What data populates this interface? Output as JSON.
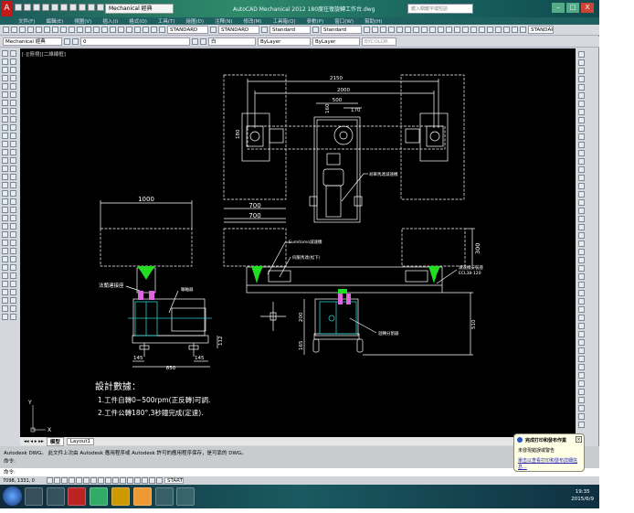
{
  "window": {
    "title": "AutoCAD Mechanical 2012   180度往復旋轉工作台.dwg",
    "workspace": "Mechanical 經典",
    "search_placeholder": "鍵入關鍵字或短語",
    "controls": [
      "–",
      "□",
      "X"
    ]
  },
  "menu": [
    "文件(F)",
    "編輯(E)",
    "視圖(V)",
    "插入(I)",
    "格式(O)",
    "工具(T)",
    "繪圖(D)",
    "注釋(N)",
    "修改(M)",
    "工具箱(Q)",
    "參數(P)",
    "窗口(W)",
    "幫助(H)"
  ],
  "toolbar1": {
    "text_style": "STANDARD",
    "dim_style": "STANDARD",
    "table_style": "Standard",
    "mleader_style": "Standard",
    "right_style": "STANDARD"
  },
  "toolbar2": {
    "workspace": "Mechanical 經典",
    "layer": "0",
    "color": "白",
    "linetype": "ByLayer",
    "lineweight": "ByLayer",
    "plotstyle": "BYCOLOR"
  },
  "viewport_label": "[-][俯視][二維線框]",
  "drawing": {
    "dims": {
      "d2150": "2150",
      "d2000": "2000",
      "d500": "500",
      "d170": "170",
      "d160": "160",
      "d180": "180",
      "d700a": "700",
      "d700b": "700",
      "d1000": "1000",
      "d112": "112",
      "d145a": "145",
      "d145b": "145",
      "d850": "850",
      "d300": "300",
      "d200": "200",
      "d165": "165",
      "d510": "510"
    },
    "labels": {
      "brake_motor": "刹車馬達減速機",
      "flange": "法蘭連接座",
      "coupling": "聯軸器",
      "sumitomo": "Sumitomo減速機",
      "servo": "伺服馬達(松下)",
      "reducer_seat": "減速機安裝座",
      "reducer_model": "ECL38-120",
      "indexer": "迴轉分割器"
    },
    "notes": {
      "title": "設計數據：",
      "line1": "1.工件自轉0~500rpm(正反轉)可調.",
      "line2": "2.工件公轉180°,3秒鐘完成(定速)."
    },
    "ucs": {
      "x": "X",
      "y": "Y"
    }
  },
  "tabs": [
    "模型",
    "Layout1"
  ],
  "command": {
    "history1": "Autodesk DWG。  此文件上次由 Autodesk 應用程序或 Autodesk 許可的應用程序保存，是可靠的 DWG。",
    "history2": "命令:",
    "prompt": "命令:"
  },
  "status": {
    "coords": "7098, 1331, 0",
    "start": "START"
  },
  "balloon": {
    "title": "完成打印和發布作業",
    "line": "未發現錯誤或警告",
    "link": "單击以查看打印和發布詳細信息..."
  },
  "clock": {
    "time": "19:35",
    "date": "2015/6/9"
  },
  "colors": {
    "canvas": "#000000",
    "green": "#22dd22",
    "cyan": "#22cccc",
    "magenta": "#dd66dd",
    "line": "#ffffff"
  }
}
